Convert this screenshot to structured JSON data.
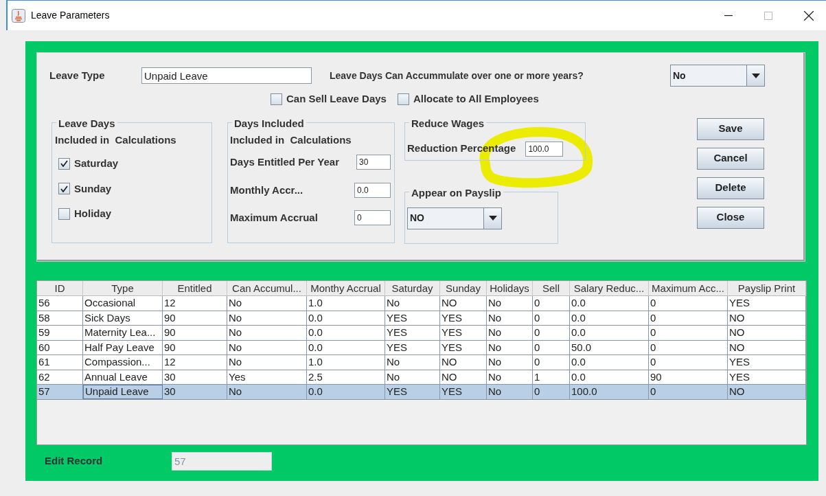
{
  "window": {
    "title": "Leave Parameters"
  },
  "form": {
    "leave_type": {
      "label": "Leave Type",
      "value": "Unpaid Leave"
    },
    "accumulate": {
      "label": "Leave Days Can Accummulate over one or more years?",
      "value": "No"
    },
    "options": [
      {
        "label": "Can Sell Leave Days",
        "checked": false
      },
      {
        "label": "Allocate to All Employees",
        "checked": false
      }
    ],
    "leave_days": {
      "title": "Leave Days",
      "subtitle": "Included in  Calculations",
      "days": [
        {
          "label": "Saturday",
          "checked": true
        },
        {
          "label": "Sunday",
          "checked": true
        },
        {
          "label": "Holiday",
          "checked": false
        }
      ]
    },
    "days_included": {
      "title": "Days Included",
      "subtitle": "Included in  Calculations",
      "fields": [
        {
          "label": "Days Entitled Per Year",
          "value": "30"
        },
        {
          "label": "Monthly Accr...",
          "value": "0.0"
        },
        {
          "label": "Maximum Accrual",
          "value": "0"
        }
      ]
    },
    "reduce_wages": {
      "title": "Reduce Wages",
      "label": "Reduction Percentage",
      "value": "100.0",
      "highlighted": true
    },
    "payslip": {
      "title": "Appear on Payslip",
      "value": "NO"
    },
    "buttons": [
      "Save",
      "Cancel",
      "Delete",
      "Close"
    ]
  },
  "table": {
    "columns": [
      "ID",
      "Type",
      "Entitled",
      "Can Accumul...",
      "Monthy  Accrual",
      "Saturday",
      "Sunday",
      "Holidays",
      "Sell",
      "Salary Reduc...",
      "Maximum Acc...",
      "Payslip Print"
    ],
    "rows": [
      {
        "cells": [
          "56",
          "Occasional",
          "12",
          "No",
          "1.0",
          "No",
          "NO",
          "No",
          "0",
          "0.0",
          "0",
          "YES"
        ],
        "selected": false
      },
      {
        "cells": [
          "58",
          "Sick Days",
          "90",
          "No",
          "0.0",
          "YES",
          "YES",
          "No",
          "0",
          "0.0",
          "0",
          "NO"
        ],
        "selected": false
      },
      {
        "cells": [
          "59",
          "Maternity Lea...",
          "90",
          "No",
          "0.0",
          "YES",
          "YES",
          "No",
          "0",
          "0.0",
          "0",
          "NO"
        ],
        "selected": false
      },
      {
        "cells": [
          "60",
          "Half Pay Leave",
          "90",
          "No",
          "0.0",
          "YES",
          "YES",
          "No",
          "0",
          "50.0",
          "0",
          "NO"
        ],
        "selected": false
      },
      {
        "cells": [
          "61",
          "Compassion...",
          "12",
          "No",
          "1.0",
          "No",
          "NO",
          "No",
          "0",
          "0.0",
          "0",
          "YES"
        ],
        "selected": false
      },
      {
        "cells": [
          "62",
          "Annual Leave",
          "30",
          "Yes",
          "2.5",
          "No",
          "NO",
          "No",
          "1",
          "0.0",
          "90",
          "YES"
        ],
        "selected": false
      },
      {
        "cells": [
          "57",
          "Unpaid Leave",
          "30",
          "No",
          "0.0",
          "YES",
          "YES",
          "No",
          "0",
          "100.0",
          "0",
          "NO"
        ],
        "selected": true
      }
    ]
  },
  "edit_record": {
    "label": "Edit Record",
    "value": "57",
    "disabled": true
  }
}
